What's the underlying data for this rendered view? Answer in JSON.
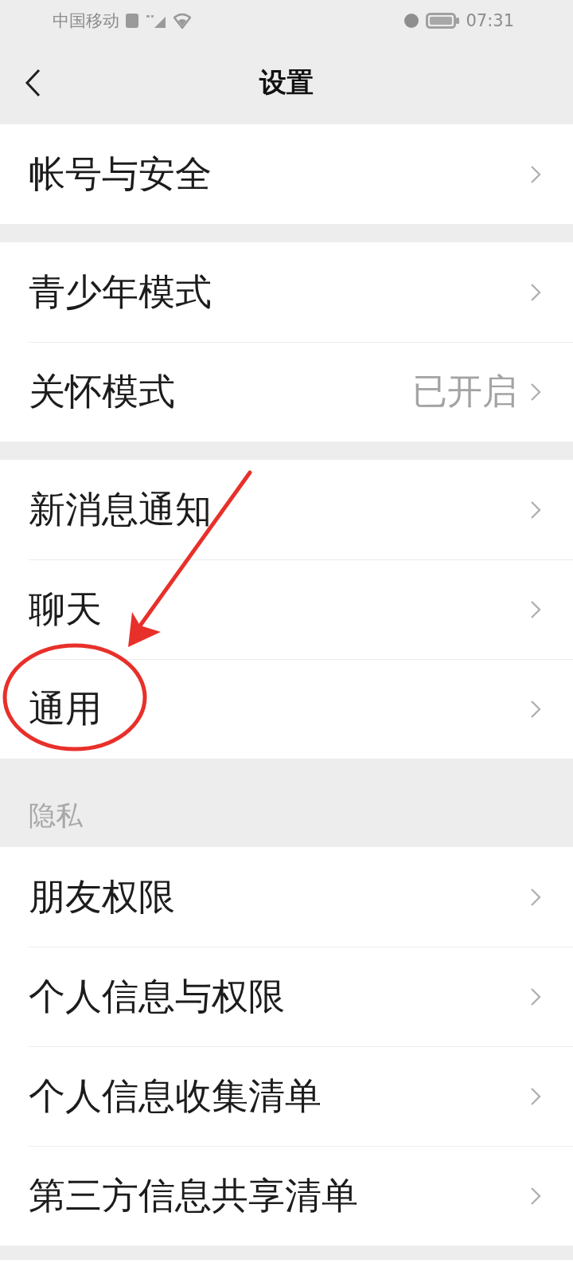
{
  "status_bar": {
    "carrier": "中国移动",
    "time": "07:31"
  },
  "header": {
    "title": "设置"
  },
  "groups": [
    {
      "items": [
        {
          "label": "帐号与安全",
          "highlighted": false
        }
      ]
    },
    {
      "items": [
        {
          "label": "青少年模式",
          "highlighted": false
        },
        {
          "label": "关怀模式",
          "value": "已开启",
          "highlighted": false
        }
      ]
    },
    {
      "items": [
        {
          "label": "新消息通知",
          "highlighted": false
        },
        {
          "label": "聊天",
          "highlighted": false
        },
        {
          "label": "通用",
          "highlighted": true
        }
      ]
    },
    {
      "title": "隐私",
      "items": [
        {
          "label": "朋友权限",
          "highlighted": false
        },
        {
          "label": "个人信息与权限",
          "highlighted": false
        },
        {
          "label": "个人信息收集清单",
          "highlighted": false
        },
        {
          "label": "第三方信息共享清单",
          "highlighted": false
        }
      ]
    }
  ]
}
